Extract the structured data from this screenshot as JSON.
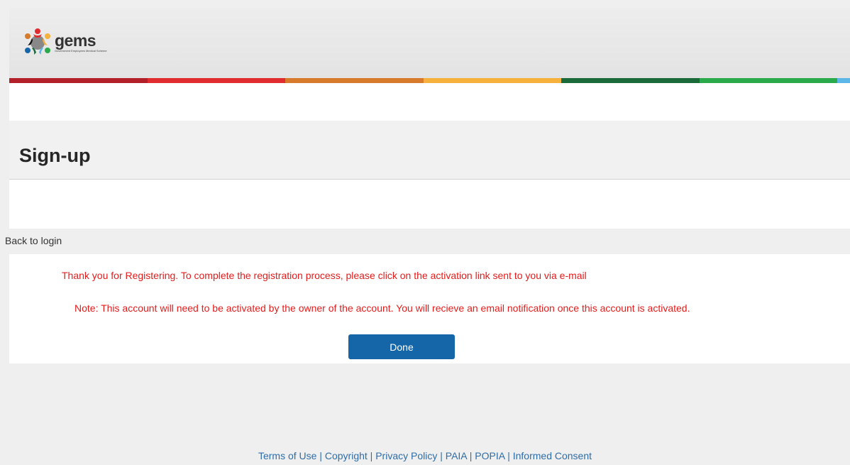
{
  "header": {
    "logo_word": "gems",
    "logo_sub": "Government Employees Medical Scheme",
    "stripe_colors": [
      "#b3202a",
      "#e02c2f",
      "#d87a2c",
      "#f5b13c",
      "#1b6b3a",
      "#2aaa4a",
      "#5cb7e8"
    ]
  },
  "page": {
    "title": "Sign-up",
    "back_link": "Back to login"
  },
  "messages": {
    "thank_you": "Thank you for Registering. To complete the registration process, please click on the activation link sent to you via e-mail",
    "note": "Note: This account will need to be activated by the owner of the account. You will recieve an email notification once this account is activated."
  },
  "actions": {
    "done_label": "Done"
  },
  "footer": {
    "links": [
      "Terms of Use",
      "Copyright",
      "Privacy Policy",
      "PAIA",
      "POPIA",
      "Informed Consent"
    ],
    "separator": "|"
  },
  "colors": {
    "message_red": "#e51b1b",
    "button_blue": "#1566a8",
    "link_blue": "#2f6da8"
  }
}
